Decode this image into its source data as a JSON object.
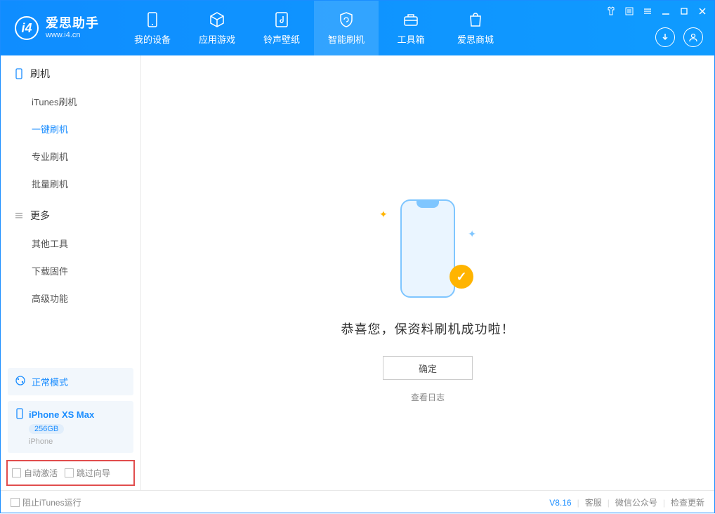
{
  "header": {
    "logo_title": "爱思助手",
    "logo_sub": "www.i4.cn",
    "tabs": [
      {
        "label": "我的设备"
      },
      {
        "label": "应用游戏"
      },
      {
        "label": "铃声壁纸"
      },
      {
        "label": "智能刷机"
      },
      {
        "label": "工具箱"
      },
      {
        "label": "爱思商城"
      }
    ]
  },
  "sidebar": {
    "section1_title": "刷机",
    "items1": [
      {
        "label": "iTunes刷机"
      },
      {
        "label": "一键刷机"
      },
      {
        "label": "专业刷机"
      },
      {
        "label": "批量刷机"
      }
    ],
    "section2_title": "更多",
    "items2": [
      {
        "label": "其他工具"
      },
      {
        "label": "下载固件"
      },
      {
        "label": "高级功能"
      }
    ],
    "mode_label": "正常模式",
    "device_name": "iPhone XS Max",
    "device_capacity": "256GB",
    "device_type": "iPhone",
    "cb_auto_activate": "自动激活",
    "cb_skip_guide": "跳过向导"
  },
  "main": {
    "success_msg": "恭喜您，保资料刷机成功啦！",
    "ok_btn": "确定",
    "log_link": "查看日志"
  },
  "footer": {
    "block_itunes": "阻止iTunes运行",
    "version": "V8.16",
    "link_service": "客服",
    "link_wechat": "微信公众号",
    "link_update": "检查更新"
  }
}
